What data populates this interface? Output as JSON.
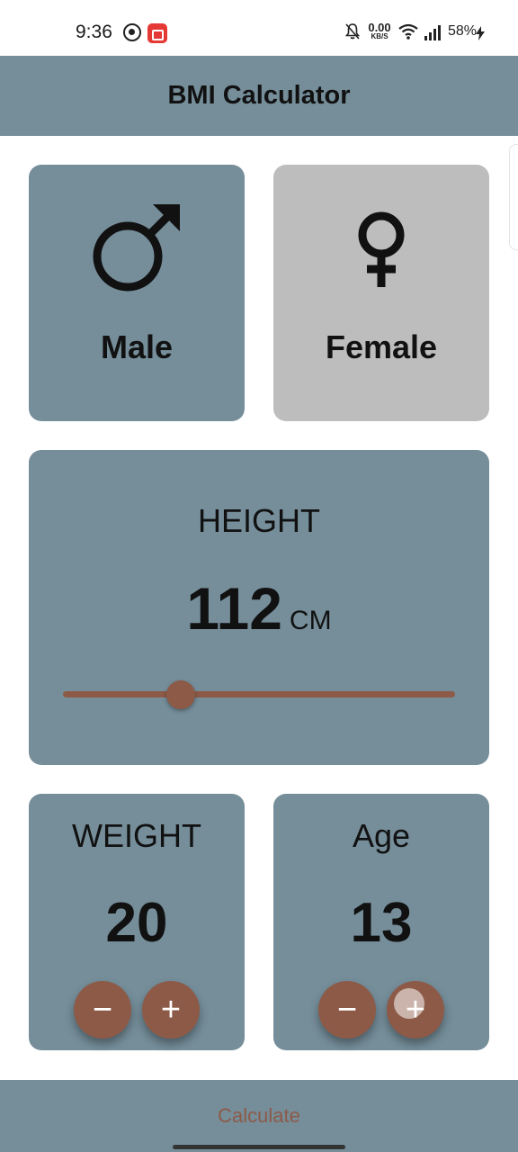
{
  "status_bar": {
    "time": "9:36",
    "net_speed_value": "0.00",
    "net_speed_unit": "KB/S",
    "battery": "58%"
  },
  "app_bar": {
    "title": "BMI Calculator"
  },
  "gender": {
    "male_label": "Male",
    "female_label": "Female",
    "selected": "male"
  },
  "height": {
    "title": "HEIGHT",
    "value": "112",
    "unit": "CM",
    "slider_fraction": 0.3
  },
  "weight": {
    "title": "WEIGHT",
    "value": "20"
  },
  "age": {
    "title": "Age",
    "value": "13"
  },
  "buttons": {
    "minus": "−",
    "plus": "+"
  },
  "footer": {
    "calculate_label": "Calculate"
  },
  "colors": {
    "primary": "#758e9a",
    "inactive": "#bdbdbd",
    "accent": "#8d5a47"
  }
}
